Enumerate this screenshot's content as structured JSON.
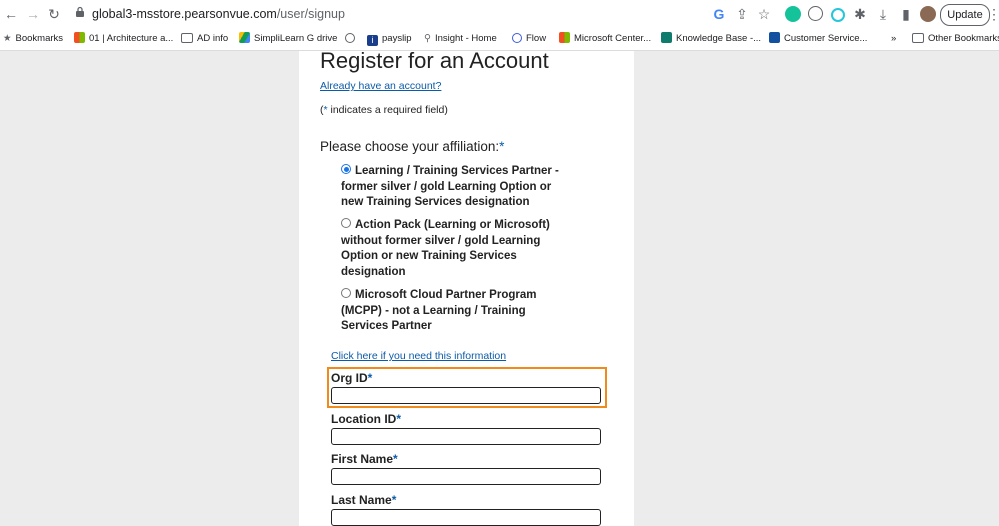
{
  "browser": {
    "url_host": "global3-msstore.pearsonvue.com",
    "url_path": "/user/signup",
    "update_label": "Update"
  },
  "bookmarks": [
    {
      "label": "Bookmarks",
      "icon": "star-icon",
      "color": "#5f6368"
    },
    {
      "label": "01 | Architecture a...",
      "icon": "microsoft-logo-icon",
      "color": "#f25022"
    },
    {
      "label": "AD info",
      "icon": "folder-icon",
      "color": "#5f6368"
    },
    {
      "label": "SimpliLearn G drive",
      "icon": "google-drive-icon",
      "color": "#0f9d58"
    },
    {
      "label": "",
      "icon": "globe-icon",
      "color": "#5f6368"
    },
    {
      "label": "payslip",
      "icon": "info-icon",
      "color": "#1a3e8c"
    },
    {
      "label": "Insight - Home",
      "icon": "search-icon",
      "color": "#5f6368"
    },
    {
      "label": "Flow",
      "icon": "flow-icon",
      "color": "#3b5bdb"
    },
    {
      "label": "Microsoft Center...",
      "icon": "microsoft-logo-icon",
      "color": "#f25022"
    },
    {
      "label": "Knowledge Base -...",
      "icon": "knowledge-base-icon",
      "color": "#0f7b6c"
    },
    {
      "label": "Customer Service...",
      "icon": "bell-logo-icon",
      "color": "#1450a0"
    },
    {
      "label": "»",
      "icon": "",
      "color": ""
    },
    {
      "label": "Other Bookmarks",
      "icon": "folder-icon",
      "color": "#5f6368"
    }
  ],
  "form": {
    "title": "Register for an Account",
    "already_link": "Already have an account?",
    "required_note_prefix": "(",
    "required_star": "*",
    "required_note_suffix": " indicates a required field)",
    "affiliation_label": "Please choose your affiliation:",
    "affiliations": [
      {
        "label": "Learning / Training Services Partner - former silver / gold Learning Option or new Training Services designation",
        "checked": true
      },
      {
        "label": "Action Pack (Learning or Microsoft) without former silver / gold Learning Option or new Training Services designation",
        "checked": false
      },
      {
        "label": "Microsoft Cloud Partner Program (MCPP) - not a Learning / Training Services Partner",
        "checked": false
      }
    ],
    "info_link": "Click here if you need this information",
    "fields": [
      {
        "label": "Org ID",
        "value": ""
      },
      {
        "label": "Location ID",
        "value": ""
      },
      {
        "label": "First Name",
        "value": ""
      },
      {
        "label": "Last Name",
        "value": ""
      }
    ],
    "highlight_color": "#f08a1c"
  }
}
